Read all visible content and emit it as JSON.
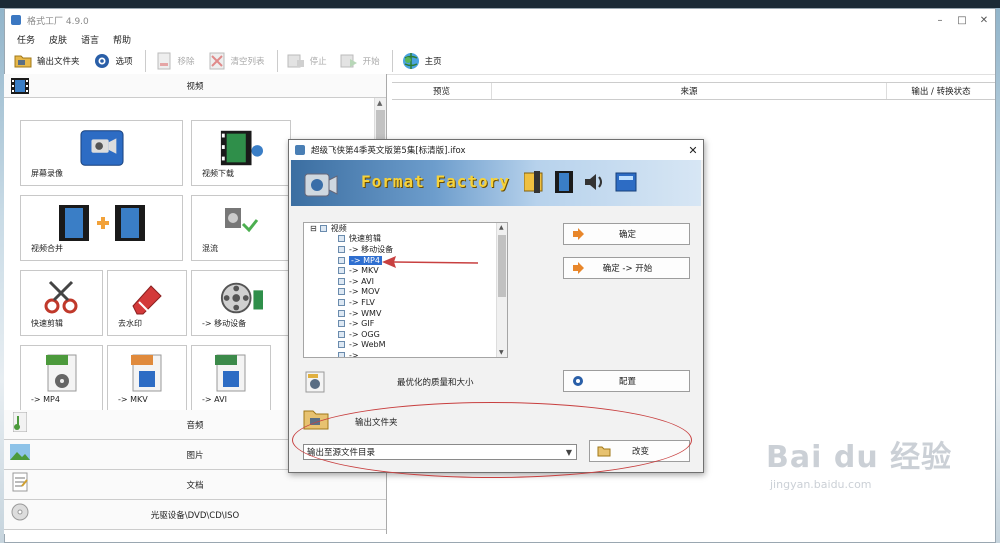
{
  "window": {
    "title": "格式工厂 4.9.0",
    "controls": [
      "–",
      "□",
      "✕"
    ]
  },
  "menu": [
    "任务",
    "皮肤",
    "语言",
    "帮助"
  ],
  "toolbar": {
    "output_folder": "输出文件夹",
    "options": "选项",
    "remove": "移除",
    "clear_list": "清空列表",
    "stop": "停止",
    "start": "开始",
    "home": "主页"
  },
  "left": {
    "video_header": "视频",
    "tiles": [
      {
        "label": "屏幕录像",
        "icon": "camera-icon"
      },
      {
        "label": "视频下载",
        "icon": "film-download-icon"
      },
      {
        "label": "视频合并",
        "icon": "video-merge-icon"
      },
      {
        "label": "混流",
        "icon": "mux-icon"
      },
      {
        "label": "快速剪辑",
        "icon": "scissors-icon"
      },
      {
        "label": "去水印",
        "icon": "eraser-icon"
      },
      {
        "label": "-> 移动设备",
        "icon": "film-reel-icon"
      },
      {
        "label": "-> MP4",
        "icon": "mp4-file-icon",
        "badge": "MP4"
      },
      {
        "label": "-> MKV",
        "icon": "mkv-file-icon",
        "badge": "MKV"
      },
      {
        "label": "-> AVI",
        "icon": "avi-file-icon",
        "badge": "AVI"
      }
    ],
    "bottom_categories": [
      "音频",
      "图片",
      "文档",
      "光驱设备\\DVD\\CD\\ISO"
    ]
  },
  "right": {
    "columns": [
      "预览",
      "来源",
      "输出 / 转换状态"
    ]
  },
  "dialog": {
    "title": "超级飞侠第4季英文版第5集[标清版].ifox",
    "banner_text": "Format Factory",
    "tree": [
      {
        "label": "视频",
        "level": 0,
        "prefix": "⊟"
      },
      {
        "label": "快速剪辑",
        "level": 1
      },
      {
        "label": "-> 移动设备",
        "level": 1
      },
      {
        "label": "-> MP4",
        "level": 1,
        "selected": true
      },
      {
        "label": "-> MKV",
        "level": 1
      },
      {
        "label": "-> AVI",
        "level": 1
      },
      {
        "label": "-> MOV",
        "level": 1
      },
      {
        "label": "-> FLV",
        "level": 1
      },
      {
        "label": "-> WMV",
        "level": 1
      },
      {
        "label": "-> GIF",
        "level": 1
      },
      {
        "label": "-> OGG",
        "level": 1
      },
      {
        "label": "-> WebM",
        "level": 1
      },
      {
        "label": "-> ...",
        "level": 1
      }
    ],
    "ok": "确定",
    "ok_start": "确定 -> 开始",
    "quality_label": "最优化的质量和大小",
    "config": "配置",
    "output_folder_label": "输出文件夹",
    "output_select": "输出至源文件目录",
    "change": "改变"
  },
  "watermark": {
    "logo": "Bai du 经验",
    "url": "jingyan.baidu.com"
  },
  "colors": {
    "selection": "#2f6fd0",
    "annotation": "#c84040",
    "banner_text": "#f6d23a"
  }
}
